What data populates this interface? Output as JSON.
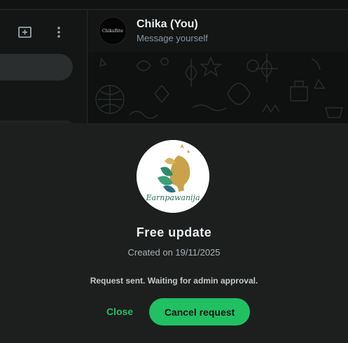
{
  "chat": {
    "name": "Chika (You)",
    "subtitle": "Message yourself",
    "avatar_text": "ChikaBite"
  },
  "left_panel": {
    "icons": [
      "new-chat-icon",
      "menu-icon"
    ]
  },
  "dialog": {
    "title": "Free update",
    "created": "Created on 19/11/2025",
    "status": "Request sent. Waiting for admin approval.",
    "close_label": "Close",
    "cancel_label": "Cancel request",
    "logo_text": "Earnpawanija"
  },
  "colors": {
    "accent": "#21c063",
    "modal_bg": "#1d1f1f",
    "text_primary": "#e9edef",
    "text_secondary": "#8696a0"
  }
}
